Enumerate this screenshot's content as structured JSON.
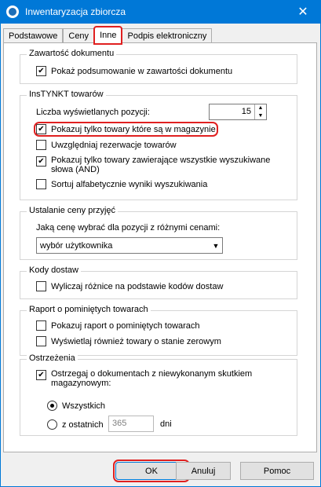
{
  "window": {
    "title": "Inwentaryzacja zbiorcza",
    "close_glyph": "✕"
  },
  "tabs": [
    {
      "label": "Podstawowe"
    },
    {
      "label": "Ceny"
    },
    {
      "label": "Inne"
    },
    {
      "label": "Podpis elektroniczny"
    }
  ],
  "zawartosc": {
    "legend": "Zawartość dokumentu",
    "show_summary": {
      "label": "Pokaż podsumowanie w zawartości dokumentu",
      "checked": true
    }
  },
  "instynkt": {
    "legend": "InsTYNKT towarów",
    "count_label": "Liczba wyświetlanych pozycji:",
    "count_value": "15",
    "only_in_stock": {
      "label": "Pokazuj tylko towary które są w magazynie",
      "checked": true
    },
    "reservation": {
      "label": "Uwzględniaj rezerwacje towarów",
      "checked": false
    },
    "all_words_line1": "Pokazuj tylko towary zawierające wszystkie wyszukiwane",
    "all_words_line2": "słowa (AND)",
    "all_words_checked": true,
    "sort_alpha": {
      "label": "Sortuj alfabetycznie wyniki wyszukiwania",
      "checked": false
    }
  },
  "price": {
    "legend": "Ustalanie ceny przyjęć",
    "question": "Jaką cenę wybrać dla pozycji z różnymi cenami:",
    "selected": "wybór użytkownika"
  },
  "codes": {
    "legend": "Kody dostaw",
    "calc_diff": {
      "label": "Wyliczaj różnice na podstawie kodów dostaw",
      "checked": false
    }
  },
  "report": {
    "legend": "Raport o pominiętych towarach",
    "show_report": {
      "label": "Pokazuj raport o pominiętych towarach",
      "checked": false
    },
    "show_zero": {
      "label": "Wyświetlaj również towary o stanie zerowym",
      "checked": false
    }
  },
  "warnings": {
    "legend": "Ostrzeżenia",
    "warn_line1": "Ostrzegaj o dokumentach z niewykonanym skutkiem",
    "warn_line2": "magazynowym:",
    "warn_checked": true,
    "radio_all": "Wszystkich",
    "radio_last": "z ostatnich",
    "days_value": "365",
    "days_unit": "dni"
  },
  "buttons": {
    "ok": "OK",
    "cancel": "Anuluj",
    "help": "Pomoc"
  },
  "colors": {
    "titlebar": "#0078d7",
    "highlight": "#e02020"
  }
}
